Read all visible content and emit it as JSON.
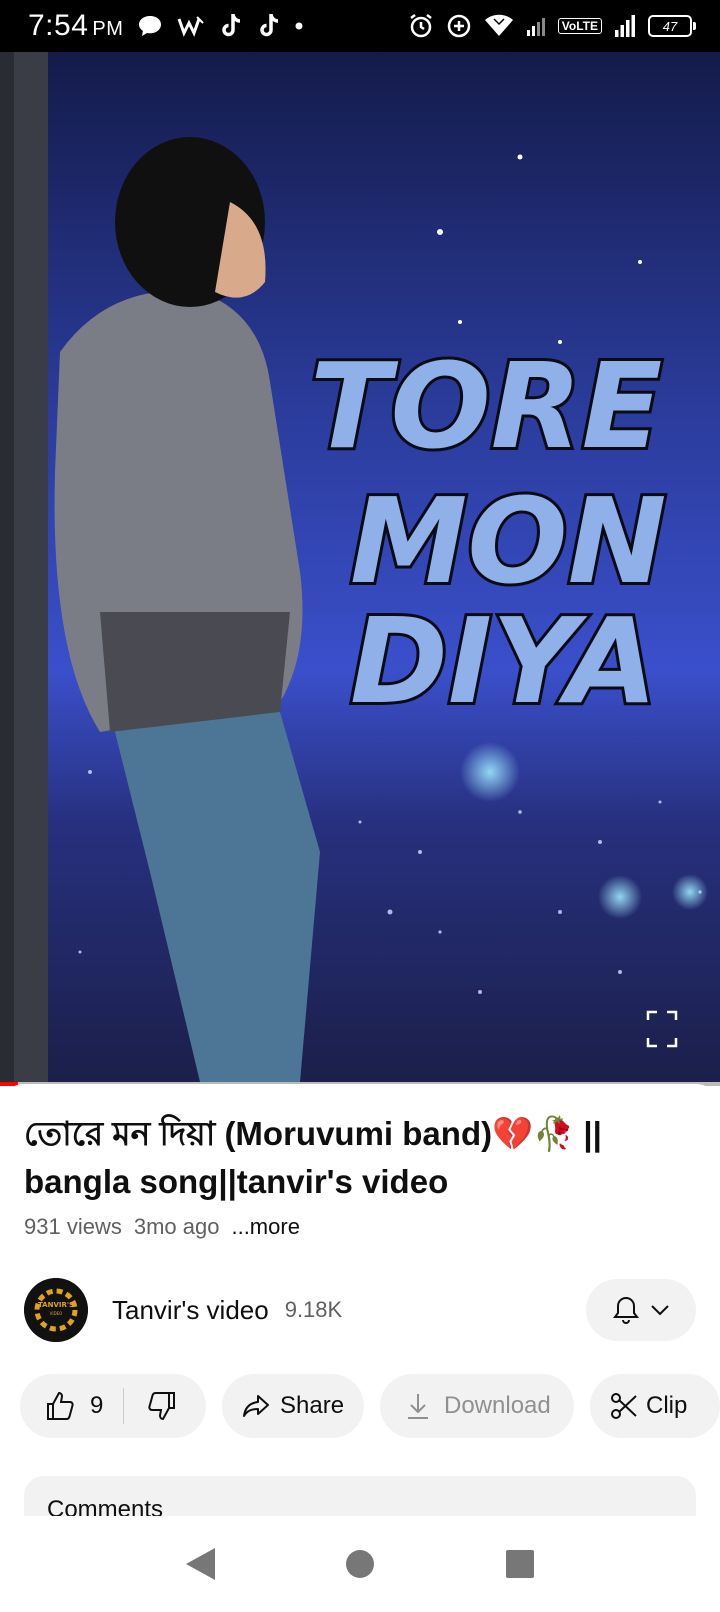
{
  "status_bar": {
    "time": "7:54",
    "ampm": "PM",
    "volte": "VoLTE",
    "battery": "47"
  },
  "video": {
    "thumbnail_text": [
      "TORE",
      "MON",
      "DIYA"
    ],
    "progress_fraction": 0.025
  },
  "title": "তোরে মন দিয়া (Moruvumi band)💔🥀 || bangla song||tanvir's video",
  "meta": {
    "views": "931 views",
    "age": "3mo ago",
    "more": "...more"
  },
  "channel": {
    "name": "Tanvir's video",
    "subscribers": "9.18K",
    "avatar_text": "TANVIR'S",
    "avatar_subtext": "VIDEO"
  },
  "actions": {
    "like_count": "9",
    "share": "Share",
    "download": "Download",
    "clip": "Clip"
  },
  "comments": {
    "label": "Comments"
  },
  "colors": {
    "accent": "#ff0000",
    "pill_bg": "#f2f2f2",
    "secondary_text": "#606060"
  }
}
